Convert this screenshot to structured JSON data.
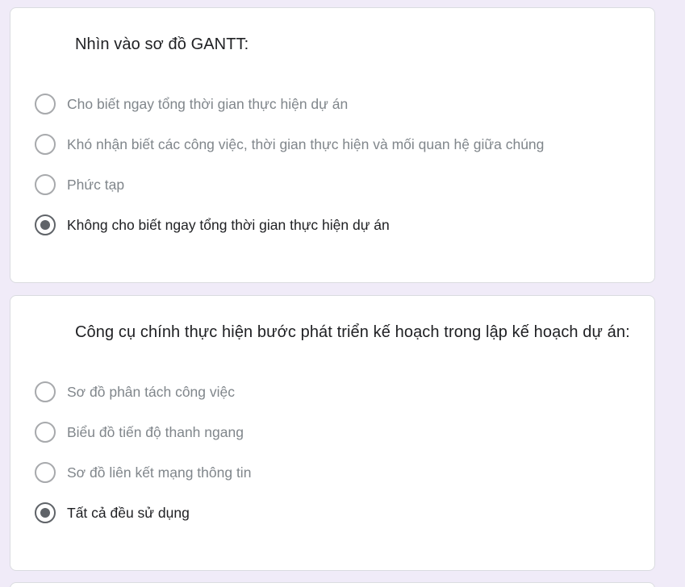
{
  "questions": [
    {
      "title": "Nhìn vào sơ đồ GANTT:",
      "options": [
        "Cho biết ngay tổng thời gian thực hiện dự án",
        "Khó nhận biết các công việc, thời gian thực hiện và mối quan hệ giữa chúng",
        "Phức tạp",
        "Không cho biết ngay tổng thời gian thực hiện dự án"
      ],
      "selected_index": 3
    },
    {
      "title": "Công cụ chính thực hiện bước phát triển kế hoạch trong lập kế hoạch dự án:",
      "options": [
        "Sơ đồ phân tách công việc",
        "Biểu đồ tiến độ thanh ngang",
        "Sơ đồ liên kết mạng thông tin",
        "Tất cả đều sử dụng"
      ],
      "selected_index": 3
    }
  ],
  "colors": {
    "page_background": "#f0ebf8",
    "card_background": "#ffffff",
    "radio": "#5f6368",
    "selected_text": "#202124",
    "unselected_text": "#80868b"
  }
}
